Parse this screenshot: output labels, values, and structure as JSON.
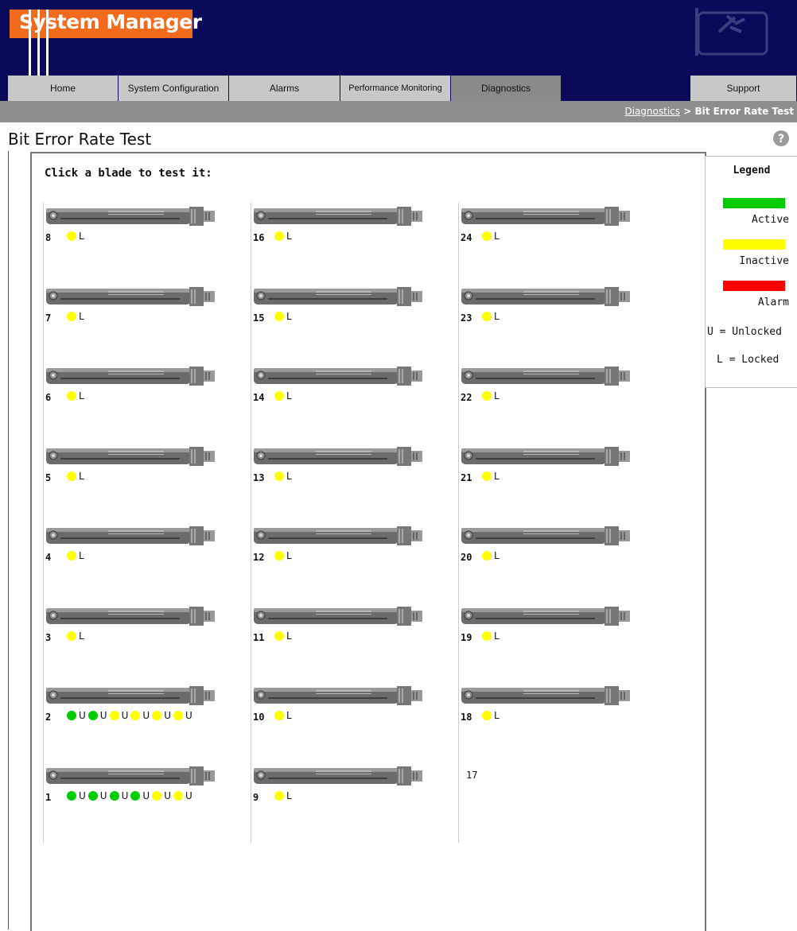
{
  "header": {
    "logo": "System Manager"
  },
  "nav": {
    "tabs": [
      {
        "label": "Home"
      },
      {
        "label": "System Configuration"
      },
      {
        "label": "Alarms"
      },
      {
        "label": "Performance Monitoring"
      },
      {
        "label": "Diagnostics"
      },
      {
        "label": "Support"
      }
    ],
    "active": "Diagnostics"
  },
  "breadcrumb": {
    "link": "Diagnostics",
    "separator": ">",
    "current": "Bit Error Rate Test"
  },
  "page": {
    "title": "Bit Error Rate Test",
    "instruction": "Click a blade to test it:"
  },
  "colors": {
    "active": "#00cc00",
    "inactive": "#ffff00",
    "alarm": "#ff0000",
    "header": "#0a0a5a",
    "logo": "#f26a1b"
  },
  "blades": [
    {
      "number": "8",
      "ports": [
        {
          "status": "inactive",
          "lock": "L"
        }
      ]
    },
    {
      "number": "7",
      "ports": [
        {
          "status": "inactive",
          "lock": "L"
        }
      ]
    },
    {
      "number": "6",
      "ports": [
        {
          "status": "inactive",
          "lock": "L"
        }
      ]
    },
    {
      "number": "5",
      "ports": [
        {
          "status": "inactive",
          "lock": "L"
        }
      ]
    },
    {
      "number": "4",
      "ports": [
        {
          "status": "inactive",
          "lock": "L"
        }
      ]
    },
    {
      "number": "3",
      "ports": [
        {
          "status": "inactive",
          "lock": "L"
        }
      ]
    },
    {
      "number": "2",
      "ports": [
        {
          "status": "active",
          "lock": "U"
        },
        {
          "status": "active",
          "lock": "U"
        },
        {
          "status": "inactive",
          "lock": "U"
        },
        {
          "status": "inactive",
          "lock": "U"
        },
        {
          "status": "inactive",
          "lock": "U"
        },
        {
          "status": "inactive",
          "lock": "U"
        }
      ]
    },
    {
      "number": "1",
      "ports": [
        {
          "status": "active",
          "lock": "U"
        },
        {
          "status": "active",
          "lock": "U"
        },
        {
          "status": "active",
          "lock": "U"
        },
        {
          "status": "active",
          "lock": "U"
        },
        {
          "status": "inactive",
          "lock": "U"
        },
        {
          "status": "inactive",
          "lock": "U"
        }
      ]
    },
    {
      "number": "16",
      "ports": [
        {
          "status": "inactive",
          "lock": "L"
        }
      ]
    },
    {
      "number": "15",
      "ports": [
        {
          "status": "inactive",
          "lock": "L"
        }
      ]
    },
    {
      "number": "14",
      "ports": [
        {
          "status": "inactive",
          "lock": "L"
        }
      ]
    },
    {
      "number": "13",
      "ports": [
        {
          "status": "inactive",
          "lock": "L"
        }
      ]
    },
    {
      "number": "12",
      "ports": [
        {
          "status": "inactive",
          "lock": "L"
        }
      ]
    },
    {
      "number": "11",
      "ports": [
        {
          "status": "inactive",
          "lock": "L"
        }
      ]
    },
    {
      "number": "10",
      "ports": [
        {
          "status": "inactive",
          "lock": "L"
        }
      ]
    },
    {
      "number": "9",
      "ports": [
        {
          "status": "inactive",
          "lock": "L"
        }
      ]
    },
    {
      "number": "24",
      "ports": [
        {
          "status": "inactive",
          "lock": "L"
        }
      ]
    },
    {
      "number": "23",
      "ports": [
        {
          "status": "inactive",
          "lock": "L"
        }
      ]
    },
    {
      "number": "22",
      "ports": [
        {
          "status": "inactive",
          "lock": "L"
        }
      ]
    },
    {
      "number": "21",
      "ports": [
        {
          "status": "inactive",
          "lock": "L"
        }
      ]
    },
    {
      "number": "20",
      "ports": [
        {
          "status": "inactive",
          "lock": "L"
        }
      ]
    },
    {
      "number": "19",
      "ports": [
        {
          "status": "inactive",
          "lock": "L"
        }
      ]
    },
    {
      "number": "18",
      "ports": [
        {
          "status": "inactive",
          "lock": "L"
        }
      ]
    }
  ],
  "empty_slots": [
    "17"
  ],
  "legend": {
    "title": "Legend",
    "active": "Active",
    "inactive": "Inactive",
    "alarm": "Alarm",
    "unlocked": "U = Unlocked",
    "locked": "L = Locked"
  }
}
